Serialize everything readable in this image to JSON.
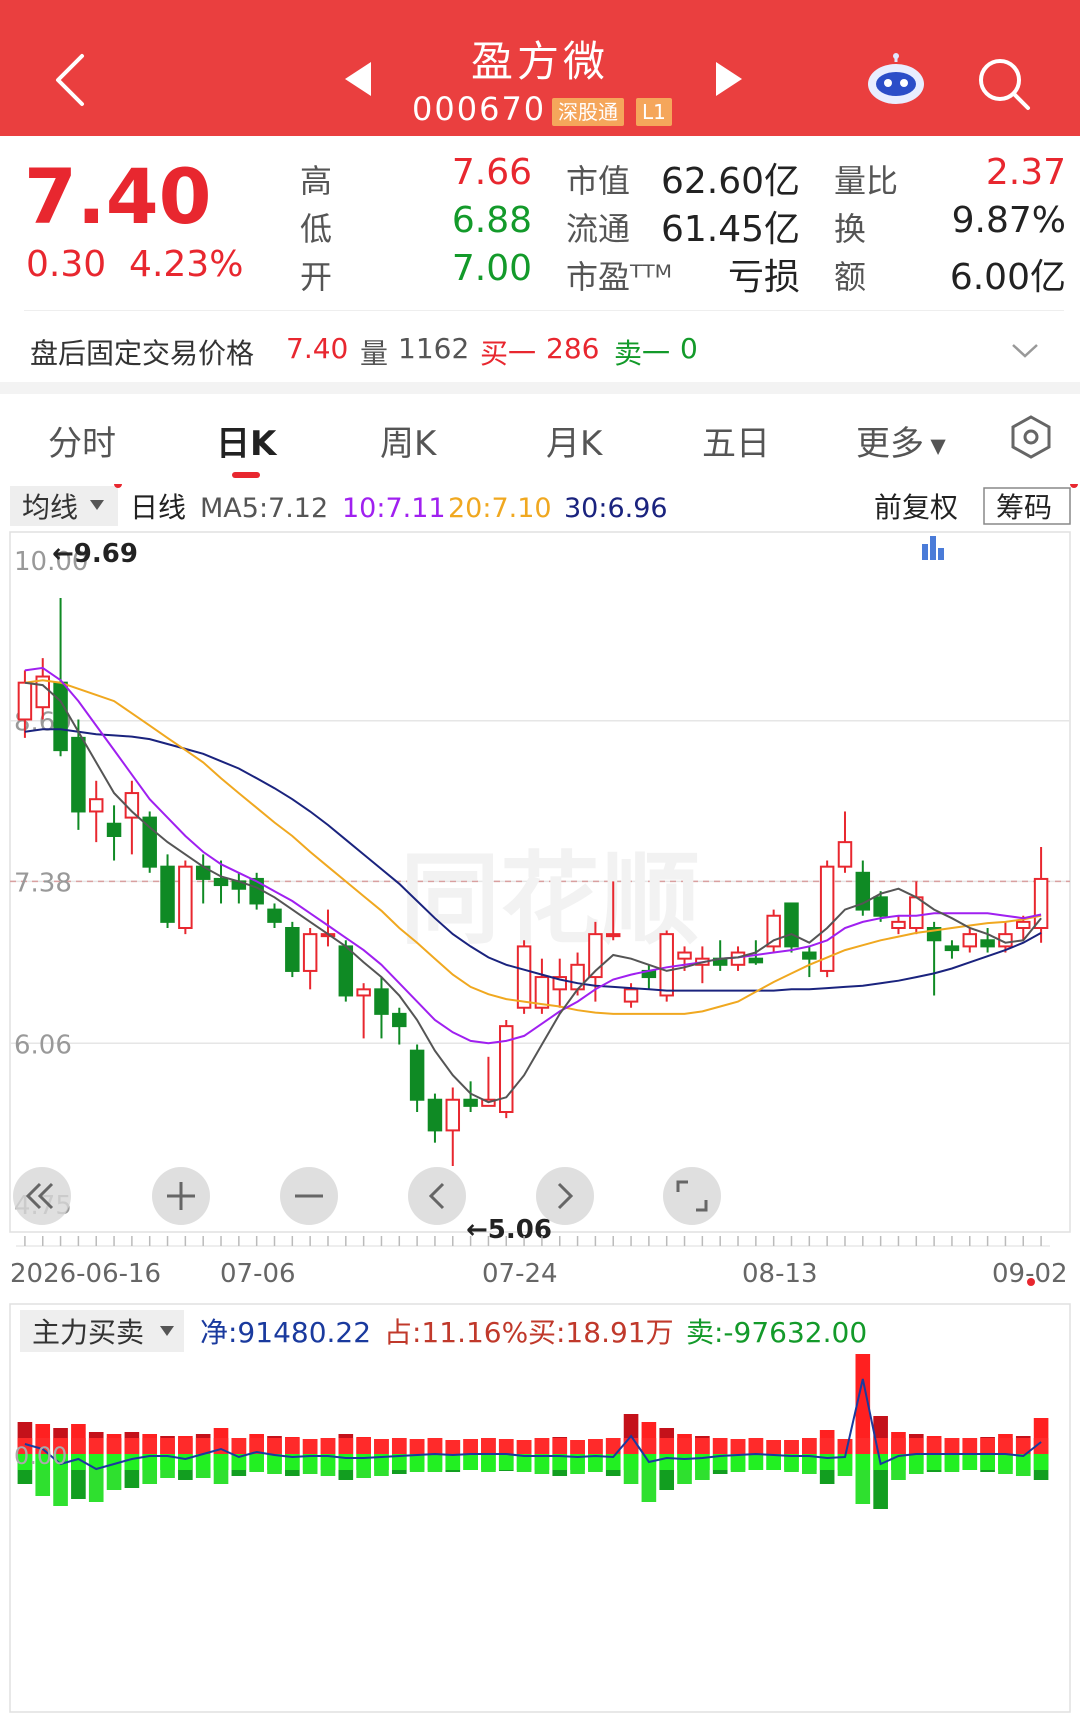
{
  "header": {
    "stock_name": "盈方微",
    "stock_code": "000670",
    "tag_market": "深股通",
    "tag_level": "L1"
  },
  "quote": {
    "price": "7.40",
    "change": "0.30",
    "change_pct": "4.23%",
    "high_label": "高",
    "high": "7.66",
    "low_label": "低",
    "low": "6.88",
    "open_label": "开",
    "open": "7.00",
    "mktcap_label": "市值",
    "mktcap": "62.60亿",
    "float_label": "流通",
    "float": "61.45亿",
    "pe_label": "市盈ᵀᵀᴹ",
    "pe": "亏损",
    "volratio_label": "量比",
    "volratio": "2.37",
    "turnover_label": "换",
    "turnover": "9.87%",
    "amount_label": "额",
    "amount": "6.00亿"
  },
  "after_hours": {
    "label": "盘后固定交易价格",
    "price": "7.40",
    "vol_label": "量",
    "vol": "1162",
    "buy_label": "买一",
    "buy": "286",
    "sell_label": "卖一",
    "sell": "0"
  },
  "tabs": [
    "分时",
    "日K",
    "周K",
    "月K",
    "五日",
    "更多"
  ],
  "indicator_bar": {
    "selector": "均线",
    "period": "日线",
    "ma5": "MA5:7.12",
    "ma10": "10:7.11",
    "ma20": "20:7.10",
    "ma30": "30:6.96",
    "adjust": "前复权",
    "chips": "筹码"
  },
  "colors": {
    "up": "#e8272f",
    "down": "#0f8a24",
    "ma5": "#555555",
    "ma10": "#a020f0",
    "ma20": "#f0a820",
    "ma30": "#1a237e"
  },
  "chart_data": {
    "type": "candlestick",
    "y_ticks": [
      "10.00",
      "8.69",
      "7.38",
      "6.06",
      "4.75"
    ],
    "x_ticks": [
      "2026-06-16",
      "07-06",
      "07-24",
      "08-13",
      "09-02"
    ],
    "ylim": [
      4.75,
      10.0
    ],
    "max_annotation": "9.69",
    "min_annotation": "5.06",
    "last_price_line": 7.38,
    "candles": [
      {
        "o": 8.7,
        "c": 9.0,
        "h": 9.1,
        "l": 8.55
      },
      {
        "o": 8.8,
        "c": 9.05,
        "h": 9.2,
        "l": 8.7
      },
      {
        "o": 9.0,
        "c": 8.45,
        "h": 9.69,
        "l": 8.4
      },
      {
        "o": 8.55,
        "c": 7.95,
        "h": 8.7,
        "l": 7.8
      },
      {
        "o": 7.95,
        "c": 8.05,
        "h": 8.2,
        "l": 7.7
      },
      {
        "o": 7.85,
        "c": 7.75,
        "h": 8.0,
        "l": 7.55
      },
      {
        "o": 7.9,
        "c": 8.1,
        "h": 8.2,
        "l": 7.6
      },
      {
        "o": 7.9,
        "c": 7.5,
        "h": 7.95,
        "l": 7.45
      },
      {
        "o": 7.5,
        "c": 7.05,
        "h": 7.6,
        "l": 7.0
      },
      {
        "o": 7.0,
        "c": 7.5,
        "h": 7.55,
        "l": 6.95
      },
      {
        "o": 7.5,
        "c": 7.4,
        "h": 7.6,
        "l": 7.2
      },
      {
        "o": 7.4,
        "c": 7.35,
        "h": 7.55,
        "l": 7.2
      },
      {
        "o": 7.38,
        "c": 7.32,
        "h": 7.45,
        "l": 7.2
      },
      {
        "o": 7.4,
        "c": 7.2,
        "h": 7.45,
        "l": 7.15
      },
      {
        "o": 7.15,
        "c": 7.05,
        "h": 7.2,
        "l": 7.0
      },
      {
        "o": 7.0,
        "c": 6.65,
        "h": 7.05,
        "l": 6.6
      },
      {
        "o": 6.65,
        "c": 6.95,
        "h": 7.0,
        "l": 6.5
      },
      {
        "o": 6.95,
        "c": 6.95,
        "h": 7.15,
        "l": 6.85
      },
      {
        "o": 6.85,
        "c": 6.45,
        "h": 6.9,
        "l": 6.4
      },
      {
        "o": 6.45,
        "c": 6.5,
        "h": 6.55,
        "l": 6.1
      },
      {
        "o": 6.5,
        "c": 6.3,
        "h": 6.6,
        "l": 6.1
      },
      {
        "o": 6.3,
        "c": 6.2,
        "h": 6.35,
        "l": 6.05
      },
      {
        "o": 6.0,
        "c": 5.6,
        "h": 6.05,
        "l": 5.5
      },
      {
        "o": 5.6,
        "c": 5.35,
        "h": 5.65,
        "l": 5.25
      },
      {
        "o": 5.35,
        "c": 5.6,
        "h": 5.7,
        "l": 5.06
      },
      {
        "o": 5.6,
        "c": 5.55,
        "h": 5.75,
        "l": 5.5
      },
      {
        "o": 5.55,
        "c": 5.6,
        "h": 5.95,
        "l": 5.55
      },
      {
        "o": 5.5,
        "c": 6.2,
        "h": 6.25,
        "l": 5.45
      },
      {
        "o": 6.35,
        "c": 6.85,
        "h": 6.9,
        "l": 6.3
      },
      {
        "o": 6.35,
        "c": 6.6,
        "h": 6.75,
        "l": 6.3
      },
      {
        "o": 6.5,
        "c": 6.6,
        "h": 6.75,
        "l": 6.35
      },
      {
        "o": 6.5,
        "c": 6.7,
        "h": 6.8,
        "l": 6.45
      },
      {
        "o": 6.6,
        "c": 6.95,
        "h": 7.05,
        "l": 6.4
      },
      {
        "o": 6.95,
        "c": 6.95,
        "h": 7.38,
        "l": 6.9
      },
      {
        "o": 6.4,
        "c": 6.5,
        "h": 6.55,
        "l": 6.35
      },
      {
        "o": 6.65,
        "c": 6.6,
        "h": 6.7,
        "l": 6.5
      },
      {
        "o": 6.45,
        "c": 6.95,
        "h": 6.98,
        "l": 6.4
      },
      {
        "o": 6.75,
        "c": 6.8,
        "h": 6.85,
        "l": 6.65
      },
      {
        "o": 6.7,
        "c": 6.75,
        "h": 6.85,
        "l": 6.55
      },
      {
        "o": 6.75,
        "c": 6.7,
        "h": 6.9,
        "l": 6.65
      },
      {
        "o": 6.7,
        "c": 6.8,
        "h": 6.85,
        "l": 6.65
      },
      {
        "o": 6.75,
        "c": 6.72,
        "h": 6.9,
        "l": 6.7
      },
      {
        "o": 6.85,
        "c": 7.1,
        "h": 7.15,
        "l": 6.8
      },
      {
        "o": 7.2,
        "c": 6.85,
        "h": 7.2,
        "l": 6.8
      },
      {
        "o": 6.8,
        "c": 6.75,
        "h": 6.85,
        "l": 6.6
      },
      {
        "o": 6.65,
        "c": 7.5,
        "h": 7.55,
        "l": 6.6
      },
      {
        "o": 7.5,
        "c": 7.7,
        "h": 7.95,
        "l": 7.45
      },
      {
        "o": 7.45,
        "c": 7.15,
        "h": 7.55,
        "l": 7.1
      },
      {
        "o": 7.25,
        "c": 7.1,
        "h": 7.3,
        "l": 7.05
      },
      {
        "o": 7.0,
        "c": 7.05,
        "h": 7.1,
        "l": 6.95
      },
      {
        "o": 7.0,
        "c": 7.25,
        "h": 7.38,
        "l": 6.95
      },
      {
        "o": 7.0,
        "c": 6.9,
        "h": 7.05,
        "l": 6.45
      },
      {
        "o": 6.85,
        "c": 6.82,
        "h": 6.9,
        "l": 6.75
      },
      {
        "o": 6.85,
        "c": 6.95,
        "h": 7.0,
        "l": 6.8
      },
      {
        "o": 6.9,
        "c": 6.85,
        "h": 7.0,
        "l": 6.8
      },
      {
        "o": 6.85,
        "c": 6.95,
        "h": 7.05,
        "l": 6.8
      },
      {
        "o": 7.0,
        "c": 7.05,
        "h": 7.1,
        "l": 6.9
      },
      {
        "o": 7.0,
        "c": 7.4,
        "h": 7.66,
        "l": 6.88
      }
    ],
    "ma5": [
      9.0,
      8.98,
      8.85,
      8.6,
      8.35,
      8.1,
      7.95,
      7.82,
      7.7,
      7.6,
      7.5,
      7.42,
      7.38,
      7.33,
      7.25,
      7.15,
      7.05,
      6.95,
      6.85,
      6.72,
      6.6,
      6.45,
      6.25,
      6.0,
      5.8,
      5.65,
      5.58,
      5.62,
      5.8,
      6.05,
      6.3,
      6.5,
      6.65,
      6.78,
      6.75,
      6.7,
      6.65,
      6.68,
      6.72,
      6.75,
      6.76,
      6.8,
      6.9,
      6.95,
      6.88,
      7.0,
      7.15,
      7.2,
      7.28,
      7.32,
      7.25,
      7.15,
      7.08,
      7.0,
      6.95,
      6.88,
      6.9,
      7.08
    ],
    "ma10": [
      9.1,
      9.12,
      9.02,
      8.85,
      8.65,
      8.45,
      8.25,
      8.05,
      7.9,
      7.75,
      7.62,
      7.52,
      7.45,
      7.38,
      7.3,
      7.22,
      7.12,
      7.02,
      6.92,
      6.82,
      6.7,
      6.55,
      6.4,
      6.25,
      6.15,
      6.08,
      6.06,
      6.08,
      6.12,
      6.22,
      6.32,
      6.4,
      6.5,
      6.58,
      6.62,
      6.65,
      6.68,
      6.7,
      6.72,
      6.75,
      6.76,
      6.78,
      6.8,
      6.82,
      6.85,
      6.9,
      7.0,
      7.05,
      7.08,
      7.1,
      7.1,
      7.12,
      7.12,
      7.12,
      7.12,
      7.1,
      7.08,
      7.11
    ],
    "ma20": [
      9.0,
      9.02,
      9.0,
      8.95,
      8.9,
      8.85,
      8.75,
      8.65,
      8.55,
      8.45,
      8.35,
      8.22,
      8.1,
      7.98,
      7.86,
      7.75,
      7.62,
      7.5,
      7.38,
      7.26,
      7.14,
      7.0,
      6.88,
      6.75,
      6.62,
      6.52,
      6.46,
      6.42,
      6.4,
      6.38,
      6.36,
      6.33,
      6.31,
      6.3,
      6.3,
      6.3,
      6.3,
      6.3,
      6.32,
      6.36,
      6.4,
      6.48,
      6.56,
      6.63,
      6.7,
      6.76,
      6.82,
      6.86,
      6.9,
      6.93,
      6.96,
      6.98,
      7.0,
      7.02,
      7.04,
      7.05,
      7.07,
      7.1
    ],
    "ma30": [
      8.6,
      8.62,
      8.62,
      8.6,
      8.58,
      8.57,
      8.56,
      8.54,
      8.5,
      8.46,
      8.42,
      8.36,
      8.3,
      8.22,
      8.14,
      8.05,
      7.95,
      7.84,
      7.72,
      7.6,
      7.48,
      7.36,
      7.22,
      7.08,
      6.95,
      6.85,
      6.76,
      6.7,
      6.66,
      6.62,
      6.58,
      6.55,
      6.53,
      6.52,
      6.51,
      6.5,
      6.49,
      6.49,
      6.49,
      6.49,
      6.49,
      6.49,
      6.49,
      6.5,
      6.5,
      6.51,
      6.52,
      6.53,
      6.55,
      6.57,
      6.6,
      6.63,
      6.67,
      6.72,
      6.77,
      6.82,
      6.88,
      6.96
    ]
  },
  "nav_controls": [
    "double-left",
    "zoom-in",
    "zoom-out",
    "prev",
    "next",
    "fullscreen"
  ],
  "flow": {
    "selector": "主力买卖",
    "net": "净:91480.22",
    "ratio": "占:11.16%",
    "buy": "买:18.91万",
    "sell": "卖:-97632.00",
    "zero_label": "0.00",
    "buy_bars": [
      0.32,
      0.3,
      0.26,
      0.3,
      0.22,
      0.2,
      0.22,
      0.2,
      0.18,
      0.18,
      0.2,
      0.26,
      0.16,
      0.2,
      0.18,
      0.17,
      0.15,
      0.16,
      0.2,
      0.17,
      0.15,
      0.16,
      0.15,
      0.16,
      0.14,
      0.15,
      0.16,
      0.15,
      0.14,
      0.16,
      0.17,
      0.14,
      0.15,
      0.16,
      0.4,
      0.32,
      0.26,
      0.2,
      0.18,
      0.16,
      0.15,
      0.16,
      0.14,
      0.14,
      0.16,
      0.24,
      0.15,
      1.0,
      0.38,
      0.22,
      0.2,
      0.18,
      0.16,
      0.16,
      0.17,
      0.2,
      0.18,
      0.36
    ],
    "sell_bars": [
      0.3,
      0.42,
      0.52,
      0.45,
      0.48,
      0.36,
      0.34,
      0.3,
      0.24,
      0.26,
      0.24,
      0.3,
      0.22,
      0.18,
      0.2,
      0.22,
      0.2,
      0.22,
      0.26,
      0.24,
      0.22,
      0.2,
      0.18,
      0.18,
      0.18,
      0.16,
      0.18,
      0.17,
      0.18,
      0.2,
      0.22,
      0.2,
      0.18,
      0.22,
      0.3,
      0.48,
      0.36,
      0.3,
      0.26,
      0.2,
      0.18,
      0.16,
      0.16,
      0.18,
      0.2,
      0.3,
      0.22,
      0.5,
      0.55,
      0.26,
      0.2,
      0.18,
      0.18,
      0.16,
      0.18,
      0.2,
      0.22,
      0.26
    ],
    "net_line": [
      0.1,
      0.05,
      -0.1,
      -0.05,
      -0.15,
      -0.1,
      -0.05,
      -0.02,
      -0.02,
      -0.05,
      0.0,
      0.05,
      -0.03,
      0.02,
      -0.01,
      -0.03,
      -0.02,
      -0.02,
      -0.04,
      -0.04,
      -0.03,
      -0.02,
      -0.01,
      0.0,
      -0.01,
      0.0,
      0.0,
      0.0,
      -0.02,
      -0.02,
      -0.02,
      -0.03,
      -0.02,
      -0.03,
      0.18,
      -0.08,
      -0.04,
      -0.05,
      -0.04,
      -0.02,
      -0.01,
      0.0,
      -0.01,
      -0.02,
      -0.02,
      -0.04,
      -0.03,
      0.75,
      -0.1,
      -0.02,
      0.0,
      0.0,
      0.0,
      0.0,
      0.0,
      0.0,
      -0.02,
      0.12
    ]
  }
}
